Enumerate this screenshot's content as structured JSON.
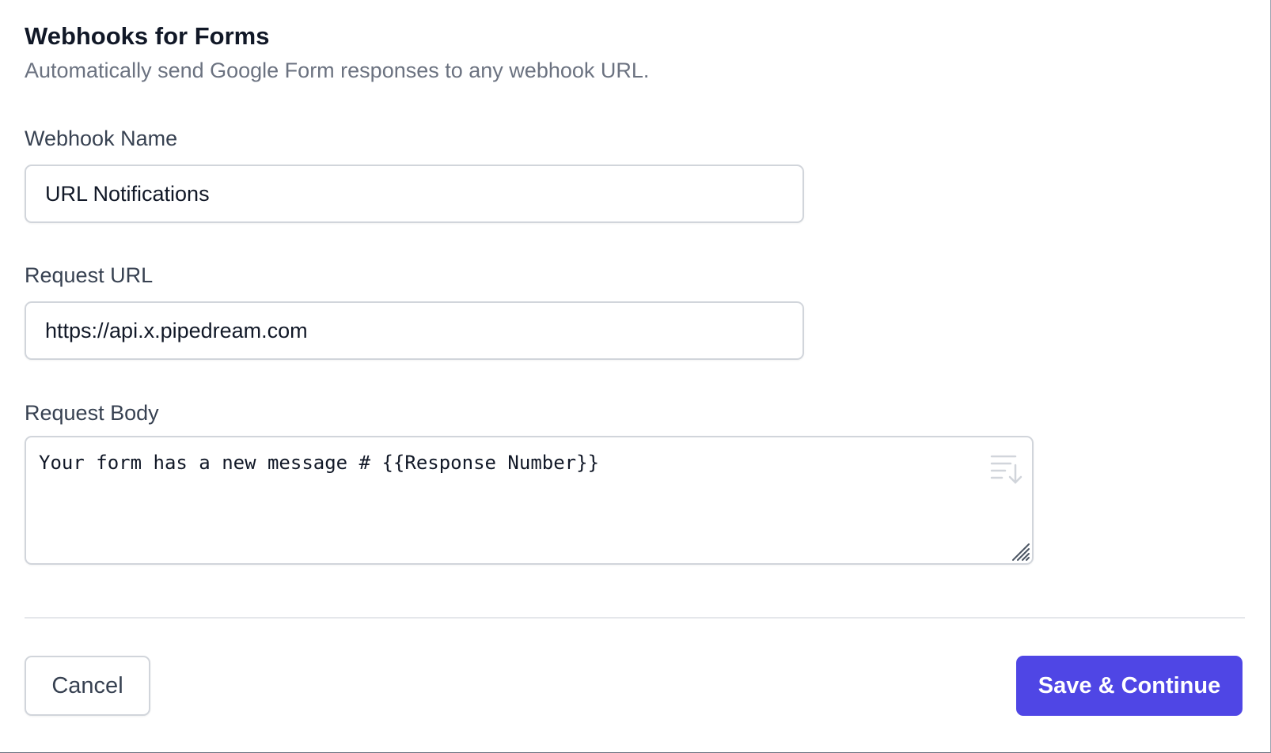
{
  "header": {
    "title": "Webhooks for Forms",
    "subtitle": "Automatically send Google Form responses to any webhook URL."
  },
  "form": {
    "webhook_name": {
      "label": "Webhook Name",
      "value": "URL Notifications"
    },
    "request_url": {
      "label": "Request URL",
      "value": "https://api.x.pipedream.com"
    },
    "request_body": {
      "label": "Request Body",
      "value": "Your form has a new message # {{Response Number}}",
      "format_icon": "sort-descending-icon"
    }
  },
  "footer": {
    "cancel_label": "Cancel",
    "save_label": "Save & Continue"
  },
  "colors": {
    "primary": "#4f46e5",
    "title": "#111827",
    "subtitle": "#6b7280",
    "label": "#374151",
    "border": "#d1d5db"
  }
}
